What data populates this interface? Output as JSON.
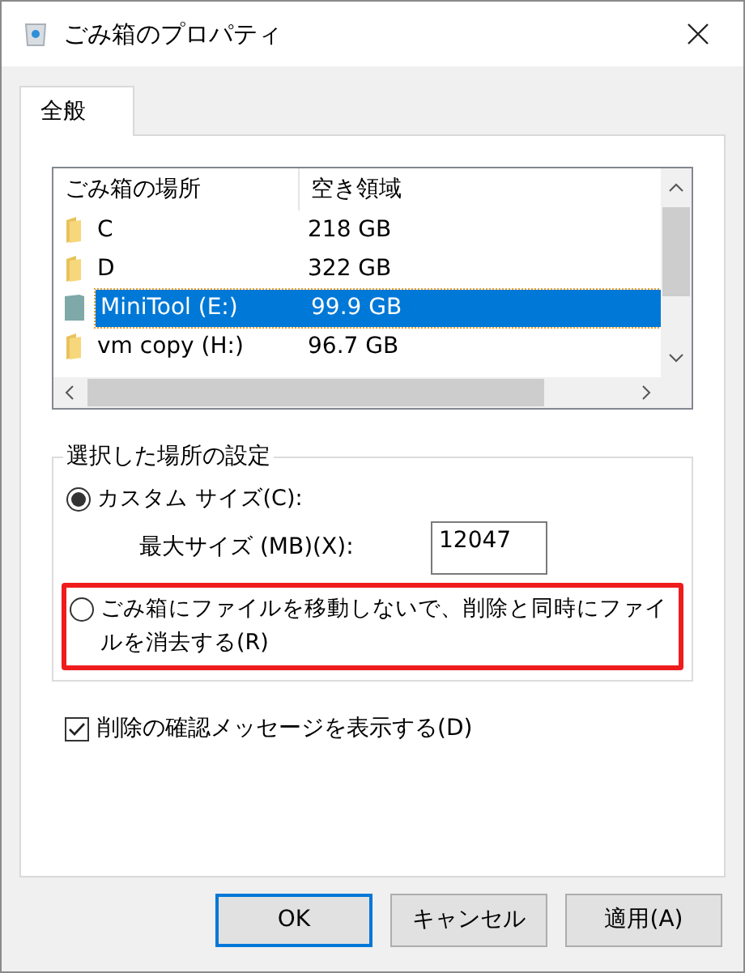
{
  "window": {
    "title": "ごみ箱のプロパティ"
  },
  "tabs": [
    {
      "label": "全般",
      "selected": true
    }
  ],
  "locations": {
    "columns": [
      "ごみ箱の場所",
      "空き領域"
    ],
    "rows": [
      {
        "name": "C",
        "free": "218 GB",
        "kind": "folder",
        "selected": false
      },
      {
        "name": "D",
        "free": "322 GB",
        "kind": "folder",
        "selected": false
      },
      {
        "name": "MiniTool (E:)",
        "free": "99.9 GB",
        "kind": "drive",
        "selected": true
      },
      {
        "name": "vm copy (H:)",
        "free": "96.7 GB",
        "kind": "folder",
        "selected": false
      }
    ]
  },
  "settings": {
    "title": "選択した場所の設定",
    "options": [
      {
        "label": "カスタム サイズ(C):",
        "selected": true,
        "highlighted": false
      },
      {
        "label": "ごみ箱にファイルを移動しないで、削除と同時にファイルを消去する(R)",
        "selected": false,
        "highlighted": true
      }
    ],
    "max_size": {
      "label": "最大サイズ (MB)(X):",
      "value": "12047"
    }
  },
  "confirm": {
    "label": "削除の確認メッセージを表示する(D)",
    "checked": true
  },
  "buttons": [
    {
      "label": "OK",
      "default": true
    },
    {
      "label": "キャンセル",
      "default": false
    },
    {
      "label": "適用(A)",
      "default": false
    }
  ]
}
